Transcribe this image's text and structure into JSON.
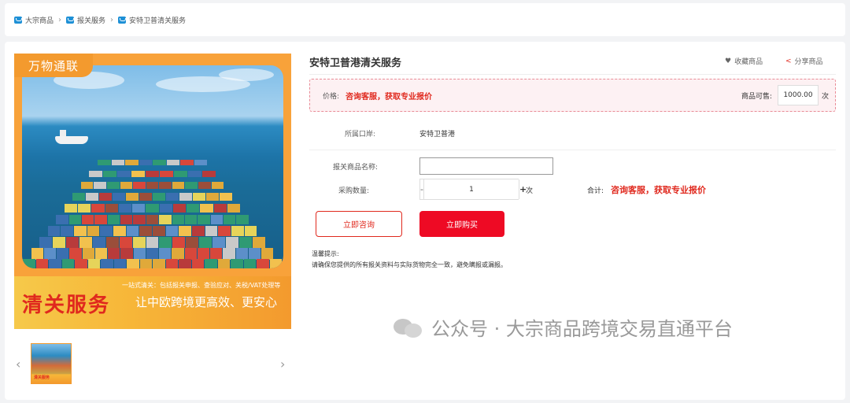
{
  "breadcrumb": [
    "大宗商品",
    "报关服务",
    "安特卫普清关服务"
  ],
  "image": {
    "badge": "万物通联",
    "title": "清关服务",
    "subtitle": "一站式清关：包括报关申报、查验应对、关税/VAT处理等",
    "slogan": "让中欧跨境更高效、更安心",
    "thumb_label": "清关服务"
  },
  "product": {
    "title": "安特卫普港清关服务",
    "favorite": "收藏商品",
    "share": "分享商品"
  },
  "price": {
    "label": "价格:",
    "value": "咨询客服，获取专业报价",
    "stock_label": "商品可售:",
    "stock_value": "1000.00",
    "unit": "次"
  },
  "port": {
    "label": "所属口岸:",
    "value": "安特卫普港"
  },
  "form": {
    "name_label": "报关商品名称:",
    "name_value": "",
    "qty_label": "采购数量:",
    "qty_value": "1",
    "minus": "-",
    "plus": "+",
    "unit": "次",
    "total_label": "合计:",
    "total_value": "咨询客服，获取专业报价"
  },
  "buttons": {
    "consult": "立即咨询",
    "buy": "立即购买"
  },
  "tips": {
    "title": "温馨提示:",
    "text": "请确保您提供的所有报关资料与实际货物完全一致，避免瞒报或漏报。"
  },
  "watermark": "公众号 · 大宗商品跨境交易直通平台",
  "colors": {
    "accent": "#ee0a24",
    "price_red": "#e0291e",
    "brand_orange": "#f39a2e"
  }
}
